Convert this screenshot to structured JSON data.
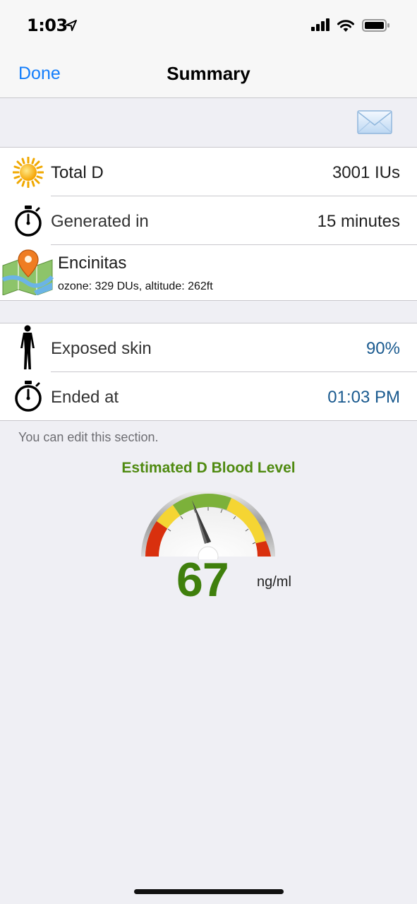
{
  "status_bar": {
    "time": "1:03",
    "icons": [
      "location-arrow-icon",
      "signal-icon",
      "wifi-icon",
      "battery-icon"
    ]
  },
  "nav": {
    "done_label": "Done",
    "title": "Summary"
  },
  "mail_icon": "envelope-icon",
  "summary": {
    "total_d": {
      "label": "Total D",
      "value": "3001 IUs",
      "icon": "sun-icon"
    },
    "generated": {
      "label": "Generated in",
      "value": "15 minutes",
      "icon": "stopwatch-icon"
    },
    "location": {
      "name": "Encinitas",
      "details": "ozone: 329 DUs, altitude: 262ft",
      "icon": "map-pin-icon"
    }
  },
  "editable": {
    "exposed_skin": {
      "label": "Exposed skin",
      "value": "90%",
      "icon": "body-silhouette-icon"
    },
    "ended_at": {
      "label": "Ended at",
      "value": "01:03 PM",
      "icon": "stopwatch-icon"
    }
  },
  "footnote": "You can edit this section.",
  "gauge": {
    "title": "Estimated D Blood Level",
    "value": "67",
    "unit": "ng/ml",
    "colors": {
      "red": "#d9300e",
      "yellow": "#f5d533",
      "green": "#7cb13a",
      "title": "#4f8a10"
    }
  },
  "colors": {
    "link": "#147efb",
    "editable_value": "#1a5a8f"
  }
}
